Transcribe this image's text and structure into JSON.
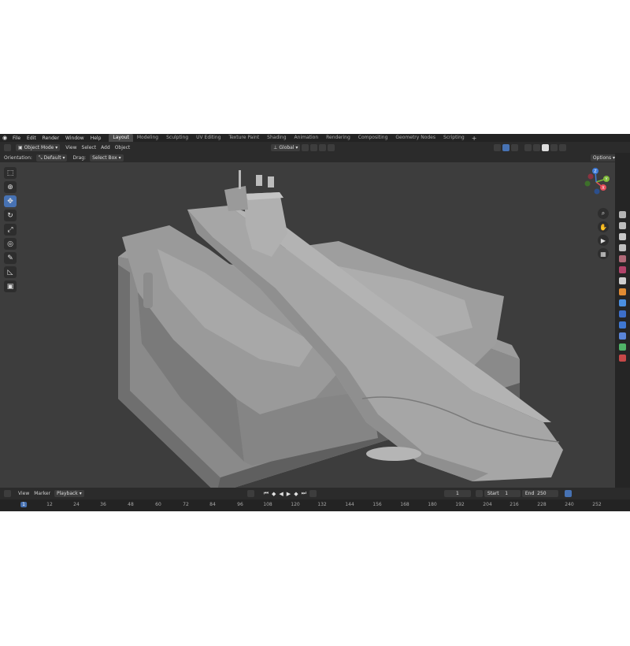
{
  "menu": [
    "File",
    "Edit",
    "Render",
    "Window",
    "Help"
  ],
  "workspaces": [
    "Layout",
    "Modeling",
    "Sculpting",
    "UV Editing",
    "Texture Paint",
    "Shading",
    "Animation",
    "Rendering",
    "Compositing",
    "Geometry Nodes",
    "Scripting"
  ],
  "active_workspace": "Layout",
  "header": {
    "mode": "Object Mode",
    "menus": [
      "View",
      "Select",
      "Add",
      "Object"
    ],
    "transform_orientation": "Global"
  },
  "tool_settings": {
    "orientation_label": "Orientation:",
    "orientation_value": "Default",
    "drag_label": "Drag:",
    "drag_value": "Select Box",
    "options": "Options"
  },
  "gizmo": {
    "x_label": "X",
    "y_label": "Y",
    "z_label": "Z"
  },
  "timeline": {
    "menus": [
      "View",
      "Marker",
      "Playback"
    ],
    "current_frame": "1",
    "start_label": "Start",
    "start_value": "1",
    "end_label": "End",
    "end_value": "250",
    "ticks": [
      "1",
      "12",
      "24",
      "36",
      "48",
      "60",
      "72",
      "84",
      "96",
      "108",
      "120",
      "132",
      "144",
      "156",
      "168",
      "180",
      "192",
      "204",
      "216",
      "228",
      "240",
      "252"
    ]
  },
  "colors": {
    "accent": "#4772b3",
    "x_axis": "#e74c5a",
    "y_axis": "#7fb93a",
    "z_axis": "#3e7ad8"
  },
  "icons": [
    "blender-logo-icon",
    "select-box-icon",
    "cursor-icon",
    "move-icon",
    "rotate-icon",
    "scale-icon",
    "transform-icon",
    "annotate-icon",
    "measure-icon",
    "add-cube-icon",
    "zoom-icon",
    "hand-icon",
    "camera-icon",
    "grid-icon"
  ]
}
